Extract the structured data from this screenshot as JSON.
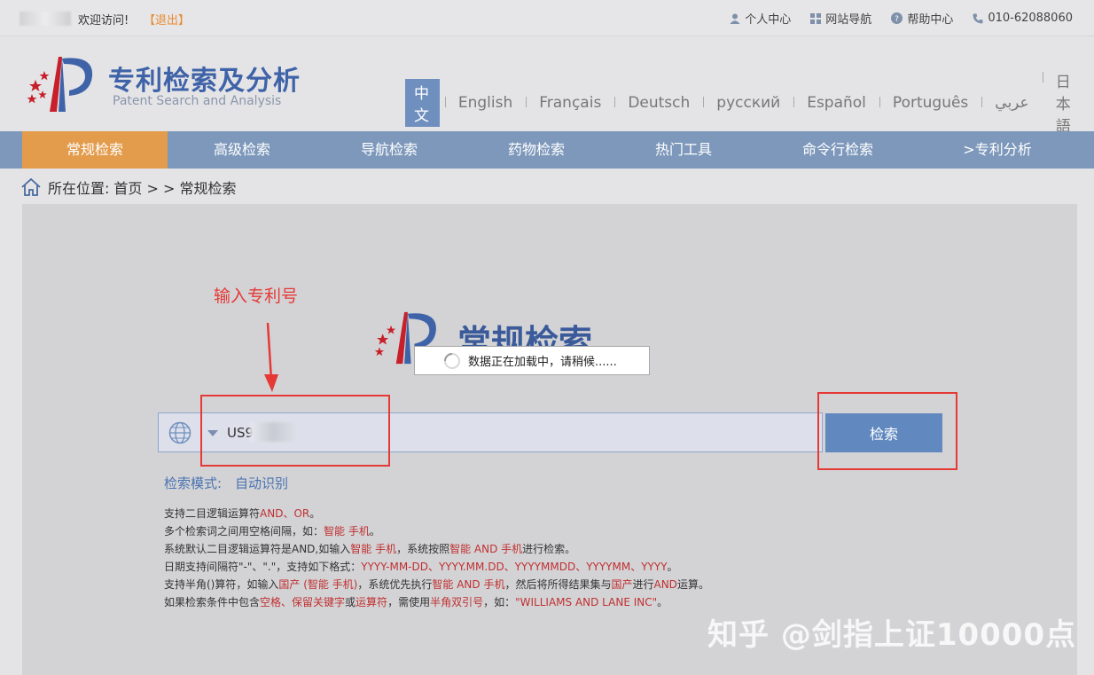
{
  "topbar": {
    "welcome": "欢迎访问!",
    "logout": "【退出】",
    "links": [
      "个人中心",
      "网站导航",
      "帮助中心",
      "010-62088060"
    ]
  },
  "header": {
    "title_cn": "专利检索及分析",
    "title_en": "Patent Search and Analysis",
    "languages": [
      "中文",
      "English",
      "Français",
      "Deutsch",
      "русский",
      "Español",
      "Português",
      "عربي",
      "日本語"
    ],
    "active_language": "中文"
  },
  "nav": {
    "items": [
      "常规检索",
      "高级检索",
      "导航检索",
      "药物检索",
      "热门工具",
      "命令行检索",
      ">专利分析"
    ],
    "active": "常规检索"
  },
  "breadcrumb": {
    "prefix": "所在位置:",
    "path": "首页 > > 常规检索"
  },
  "main": {
    "annotation": "输入专利号",
    "big_title": "常规检索",
    "loading_text": "数据正在加载中，请稍候......",
    "search_value": "US97",
    "search_button": "检索",
    "mode_label": "检索模式:",
    "mode_value": "自动识别",
    "help_lines": [
      [
        {
          "t": "支持二目逻辑运算符"
        },
        {
          "t": "AND、OR",
          "r": true
        },
        {
          "t": "。"
        }
      ],
      [
        {
          "t": "多个检索词之间用空格间隔，如："
        },
        {
          "t": "智能 手机",
          "r": true
        },
        {
          "t": "。"
        }
      ],
      [
        {
          "t": "系统默认二目逻辑运算符是AND,如输入"
        },
        {
          "t": "智能 手机",
          "r": true
        },
        {
          "t": "，系统按照"
        },
        {
          "t": "智能 AND 手机",
          "r": true
        },
        {
          "t": "进行检索。"
        }
      ],
      [
        {
          "t": "日期支持间隔符\"-\"、\".\"，支持如下格式："
        },
        {
          "t": "YYYY-MM-DD、YYYY.MM.DD、YYYYMMDD、YYYYMM、YYYY",
          "r": true
        },
        {
          "t": "。"
        }
      ],
      [
        {
          "t": "支持半角()算符，如输入"
        },
        {
          "t": "国产 (智能 手机)",
          "r": true
        },
        {
          "t": "，系统优先执行"
        },
        {
          "t": "智能 AND 手机",
          "r": true
        },
        {
          "t": "，然后将所得结果集与"
        },
        {
          "t": "国产",
          "r": true
        },
        {
          "t": "进行"
        },
        {
          "t": "AND",
          "r": true
        },
        {
          "t": "运算。"
        }
      ],
      [
        {
          "t": "如果检索条件中包含"
        },
        {
          "t": "空格、保留关键字",
          "r": true
        },
        {
          "t": "或"
        },
        {
          "t": "运算符",
          "r": true
        },
        {
          "t": "，需使用"
        },
        {
          "t": "半角双引号",
          "r": true
        },
        {
          "t": "，如："
        },
        {
          "t": "\"WILLIAMS AND LANE INC\"",
          "r": true
        },
        {
          "t": "。"
        }
      ]
    ]
  },
  "watermark": "知乎 @剑指上证10000点",
  "colors": {
    "nav_bg": "#7d98bb",
    "nav_active": "#e39b4c",
    "annotation_red": "#e53935",
    "button_blue": "#6189c0"
  }
}
